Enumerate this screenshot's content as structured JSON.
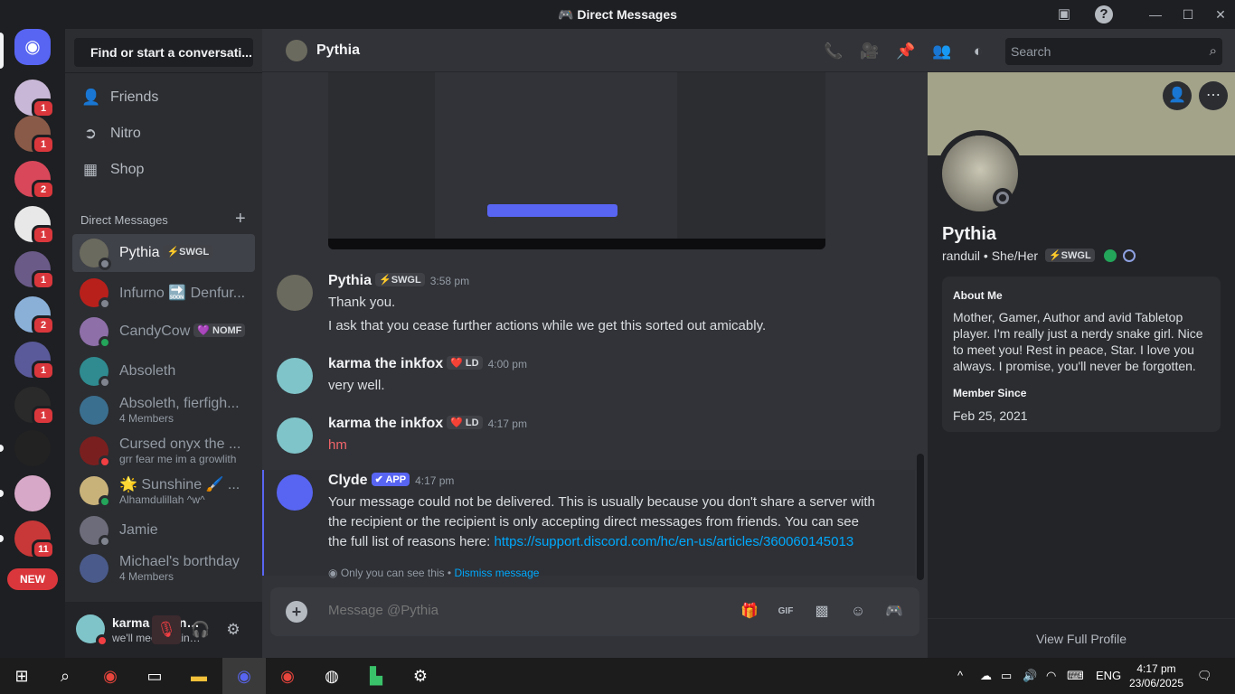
{
  "window": {
    "title": "Direct Messages"
  },
  "sidebar": {
    "find_placeholder": "Find or start a conversati...",
    "nav": [
      {
        "label": "Friends",
        "icon": "friends-icon"
      },
      {
        "label": "Nitro",
        "icon": "nitro-icon"
      },
      {
        "label": "Shop",
        "icon": "shop-icon"
      }
    ],
    "dm_header": "Direct Messages",
    "dms": [
      {
        "name": "Pythia",
        "tag": "⚡SWGL",
        "sub": "",
        "status": "offline",
        "color": "#6b6a5e"
      },
      {
        "name": "Infurno 🔜 Denfur...",
        "tag": "",
        "sub": "",
        "status": "offline",
        "color": "#b8201c"
      },
      {
        "name": "CandyCow",
        "tag": "💜 NOMF",
        "sub": "",
        "status": "online",
        "color": "#8e6fa8"
      },
      {
        "name": "Absoleth",
        "tag": "",
        "sub": "",
        "status": "offline",
        "color": "#2f8b8f"
      },
      {
        "name": "Absoleth, fierfigh...",
        "tag": "",
        "sub": "4 Members",
        "status": "",
        "color": "#3b6f8f"
      },
      {
        "name": "Cursed onyx the ...",
        "tag": "",
        "sub": "grr fear me im a growlith",
        "status": "dnd",
        "color": "#7a1f1f"
      },
      {
        "name": "🌟 Sunshine 🖌️ ...",
        "tag": "",
        "sub": "Alhamdulillah ^w^",
        "status": "online",
        "color": "#c9b27a"
      },
      {
        "name": "Jamie",
        "tag": "",
        "sub": "",
        "status": "offline",
        "color": "#6c6c7a"
      },
      {
        "name": "Michael's borthday",
        "tag": "",
        "sub": "4 Members",
        "status": "",
        "color": "#4a5a8a"
      }
    ],
    "user": {
      "name": "karma the inkf...",
      "status": "we'll meet again, ..."
    }
  },
  "rail": {
    "servers": [
      {
        "badge": "1",
        "color": "#c8b7d6"
      },
      {
        "badge": "1",
        "color": "#8a5a48"
      },
      {
        "badge": "2",
        "color": "#d8485a"
      },
      {
        "badge": "1",
        "color": "#e8e8e8"
      },
      {
        "badge": "1",
        "color": "#6a5a88"
      },
      {
        "badge": "2",
        "color": "#8ab0d8"
      },
      {
        "badge": "1",
        "color": "#5a5a9a"
      },
      {
        "badge": "1",
        "color": "#2a2a2a"
      },
      {
        "badge": "",
        "color": "#222222"
      },
      {
        "badge": "",
        "color": "#d8a8c8"
      },
      {
        "badge": "11",
        "color": "#c83838"
      }
    ],
    "new_label": "NEW"
  },
  "header": {
    "name": "Pythia",
    "search_placeholder": "Search"
  },
  "messages": [
    {
      "author": "Pythia",
      "tag": "⚡SWGL",
      "time": "3:58 pm",
      "lines": [
        "Thank you.",
        "I ask that you cease further actions while we get this sorted out amicably."
      ]
    },
    {
      "author": "karma the inkfox",
      "tag": "❤️ LD",
      "time": "4:00 pm",
      "lines": [
        "very well."
      ]
    },
    {
      "author": "karma the inkfox",
      "tag": "❤️ LD",
      "time": "4:17 pm",
      "lines": [
        "hm"
      ]
    },
    {
      "author": "Clyde",
      "tag": "✔ APP",
      "time": "4:17 pm",
      "lines": [
        "Your message could not be delivered. This is usually because you don't share a server with",
        "the recipient or the recipient is only accepting direct messages from friends. You can see",
        "the full list of reasons here: "
      ],
      "link": "https://support.discord.com/hc/en-us/articles/360060145013",
      "ephemeral": "Only you can see this •",
      "dismiss": "Dismiss message"
    }
  ],
  "composer": {
    "placeholder": "Message @Pythia"
  },
  "profile": {
    "name": "Pythia",
    "username": "randuil",
    "pronouns": "She/Her",
    "tag": "⚡SWGL",
    "about_heading": "About Me",
    "about": "Mother, Gamer, Author and avid Tabletop player. I'm really just a nerdy snake girl. Nice to meet you! Rest in peace, Star. I love you always. I promise, you'll never be forgotten.",
    "member_since_heading": "Member Since",
    "member_since": "Feb 25, 2021",
    "view_full": "View Full Profile",
    "banner_color": "#a3a38a"
  },
  "taskbar": {
    "time": "4:17 pm",
    "date": "23/06/2025",
    "lang": "ENG",
    "notif": "1"
  },
  "colors": {
    "accent": "#5865f2",
    "link": "#00a8fc",
    "danger": "#da373c",
    "online": "#23a55a"
  }
}
